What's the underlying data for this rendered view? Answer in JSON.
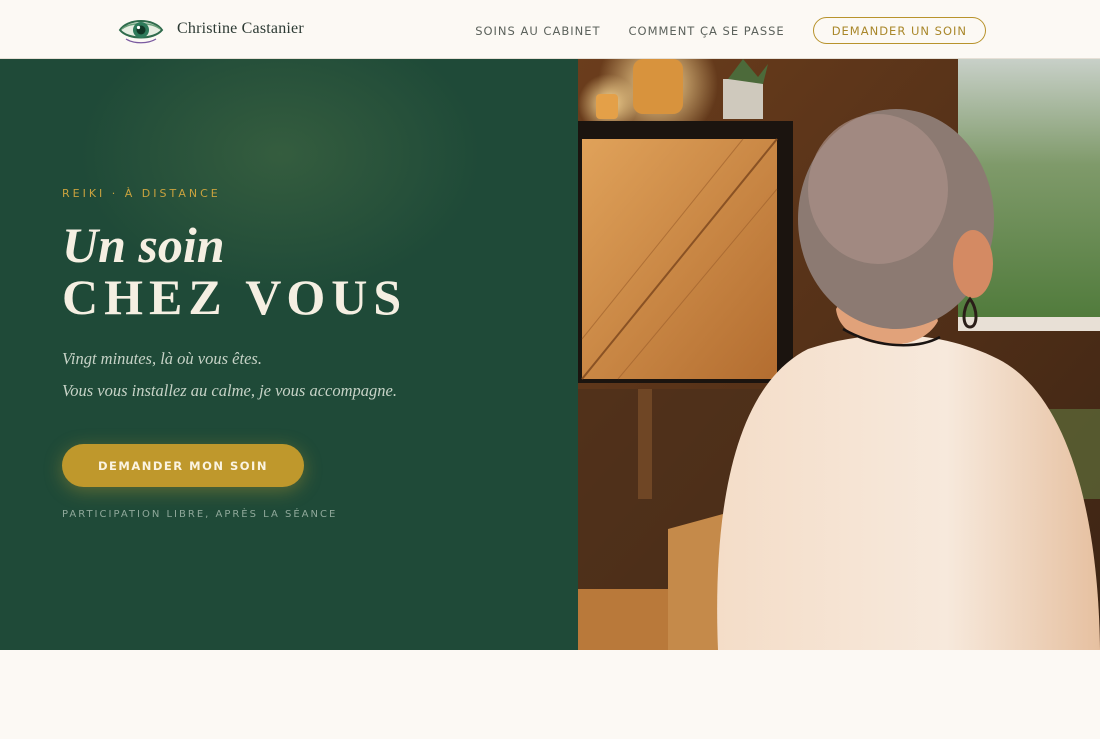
{
  "header": {
    "brand_name": "Christine Castanier",
    "nav": {
      "soins_au_cabinet": "SOINS AU CABINET",
      "comment_ca_se_passe": "COMMENT ÇA SE PASSE",
      "demander_un_soin": "DEMANDER UN SOIN"
    }
  },
  "hero": {
    "eyebrow": "REIKI · À DISTANCE",
    "title_line1": "Un soin",
    "title_line2": "CHEZ VOUS",
    "subtitle_line1": "Vingt minutes, là où vous êtes.",
    "subtitle_line2": "Vous vous installez au calme, je vous accompagne.",
    "cta_label": "DEMANDER MON SOIN",
    "note": "PARTICIPATION LIBRE, APRÈS LA SÉANCE"
  },
  "colors": {
    "hero_green": "#1f4a38",
    "gold_accent": "#bf982c",
    "page_background": "#fcf9f4"
  },
  "icons": {
    "logo": "eye-logo-icon"
  }
}
